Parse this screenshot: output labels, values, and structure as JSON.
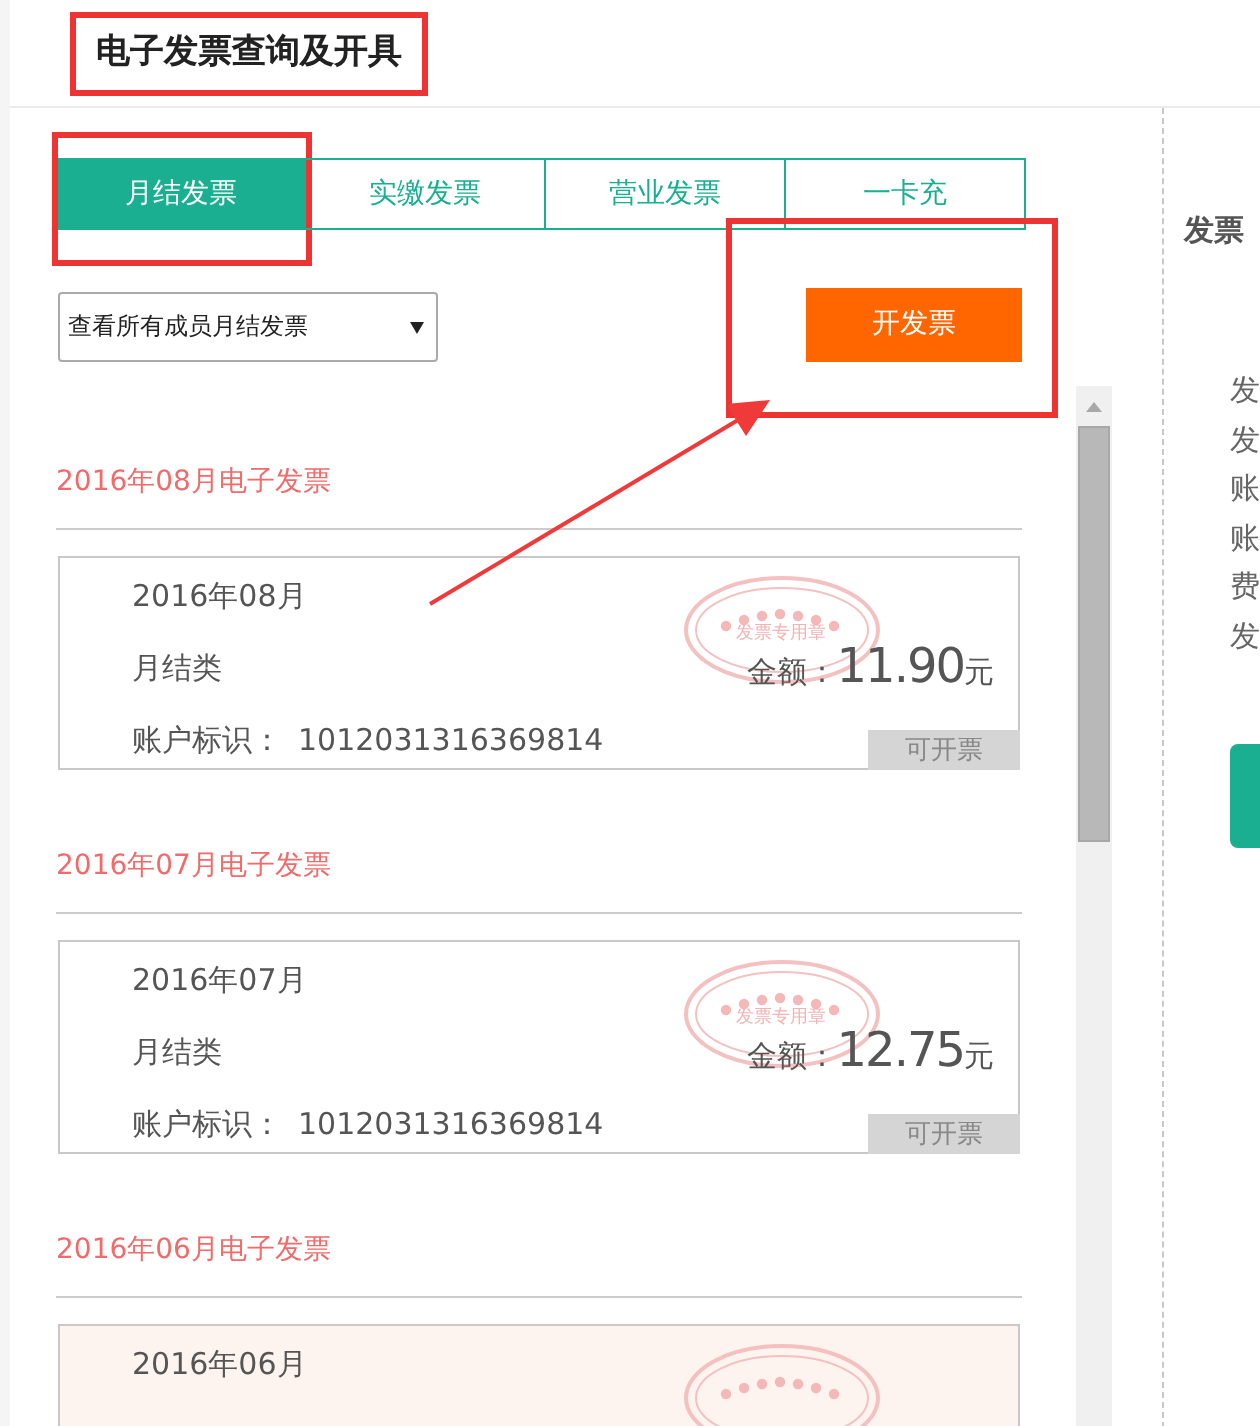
{
  "page": {
    "title": "电子发票查询及开具",
    "highlighted": true
  },
  "tabs": [
    {
      "label": "月结发票",
      "selected": true,
      "highlighted": true
    },
    {
      "label": "实缴发票",
      "selected": false,
      "highlighted": false
    },
    {
      "label": "营业发票",
      "selected": false,
      "highlighted": false
    },
    {
      "label": "一卡充",
      "selected": false,
      "highlighted": false
    }
  ],
  "filter": {
    "value": "查看所有成员月结发票"
  },
  "issue_button": {
    "label": "开发票",
    "highlighted": true,
    "arrow": true
  },
  "sections": [
    {
      "heading": "2016年08月电子发票",
      "card": {
        "selected": false,
        "month": "2016年08月",
        "type": "月结类",
        "amount_label": "金额：",
        "amount": "11.90",
        "unit": "元",
        "account_label": "账户标识：",
        "account": "1012031316369814",
        "status": "可开票",
        "stamp": "发票专用章"
      }
    },
    {
      "heading": "2016年07月电子发票",
      "card": {
        "selected": false,
        "month": "2016年07月",
        "type": "月结类",
        "amount_label": "金额：",
        "amount": "12.75",
        "unit": "元",
        "account_label": "账户标识：",
        "account": "1012031316369814",
        "status": "可开票",
        "stamp": "发票专用章"
      }
    },
    {
      "heading": "2016年06月电子发票",
      "card": {
        "selected": true,
        "month": "2016年06月"
      }
    }
  ],
  "side_panel": {
    "title": "发票",
    "lines": [
      "发",
      "发",
      "账",
      "账",
      "费",
      "发"
    ]
  }
}
